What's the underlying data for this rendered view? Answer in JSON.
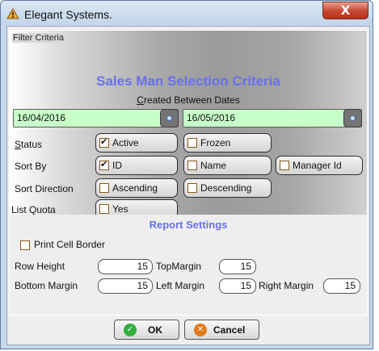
{
  "window": {
    "title": "Elegant Systems.",
    "close_label": "X"
  },
  "filter": {
    "legend": "Filter Criteria",
    "heading": "Sales Man Selection Criteria",
    "subtitle_ul": "C",
    "subtitle_rest": "reated Between Dates",
    "from_date": "16/04/2016",
    "to_date": "16/05/2016",
    "status_label_ul": "S",
    "status_label_rest": "tatus",
    "sortby_label": "Sort By",
    "sortdir_label": "Sort Direction",
    "listquota_label": "List Quota",
    "status_options": [
      {
        "label": "Active",
        "checked": true
      },
      {
        "label": "Frozen",
        "checked": false
      }
    ],
    "sortby_options": [
      {
        "label": "ID",
        "checked": true
      },
      {
        "label": "Name",
        "checked": false
      },
      {
        "label": "Manager Id",
        "checked": false
      }
    ],
    "sortdir_options": [
      {
        "label": "Ascending",
        "checked": false
      },
      {
        "label": "Descending",
        "checked": false
      }
    ],
    "listquota_options": [
      {
        "label": "Yes",
        "checked": false
      }
    ]
  },
  "report": {
    "title": "Report Settings",
    "print_cell_border_label": "Print Cell Border",
    "print_cell_border_checked": false,
    "row_height_label": "Row Height",
    "row_height": "15",
    "top_margin_label": "TopMargin",
    "top_margin": "15",
    "bottom_margin_label": "Bottom Margin",
    "bottom_margin": "15",
    "left_margin_label": "Left Margin",
    "left_margin": "15",
    "right_margin_label": "Right Margin",
    "right_margin": "15"
  },
  "buttons": {
    "ok_label": "OK",
    "cancel_label": "Cancel"
  },
  "colors": {
    "heading": "#6670ee",
    "date_field_bg": "#c8ffc8",
    "ok_icon": "#2fae3e",
    "cancel_icon": "#e07b1a",
    "close_button": "#c6452f"
  },
  "icons": {
    "app": "warning-triangle-icon",
    "ok": "check-circle-icon",
    "cancel": "cancel-circle-icon",
    "date_picker": "calendar-dot-icon"
  }
}
